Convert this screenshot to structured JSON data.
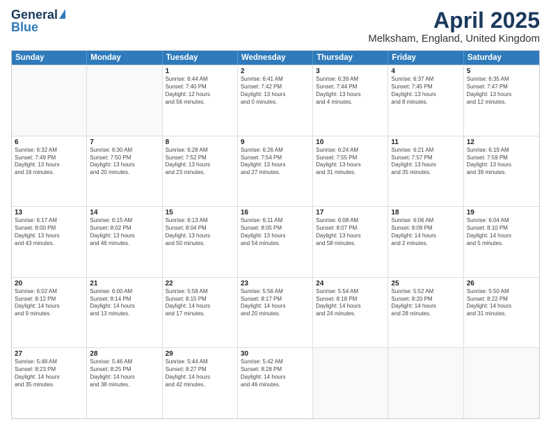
{
  "logo": {
    "general": "General",
    "blue": "Blue"
  },
  "title": "April 2025",
  "subtitle": "Melksham, England, United Kingdom",
  "weekdays": [
    "Sunday",
    "Monday",
    "Tuesday",
    "Wednesday",
    "Thursday",
    "Friday",
    "Saturday"
  ],
  "rows": [
    [
      {
        "day": "",
        "lines": []
      },
      {
        "day": "",
        "lines": []
      },
      {
        "day": "1",
        "lines": [
          "Sunrise: 6:44 AM",
          "Sunset: 7:40 PM",
          "Daylight: 12 hours",
          "and 56 minutes."
        ]
      },
      {
        "day": "2",
        "lines": [
          "Sunrise: 6:41 AM",
          "Sunset: 7:42 PM",
          "Daylight: 13 hours",
          "and 0 minutes."
        ]
      },
      {
        "day": "3",
        "lines": [
          "Sunrise: 6:39 AM",
          "Sunset: 7:44 PM",
          "Daylight: 13 hours",
          "and 4 minutes."
        ]
      },
      {
        "day": "4",
        "lines": [
          "Sunrise: 6:37 AM",
          "Sunset: 7:45 PM",
          "Daylight: 13 hours",
          "and 8 minutes."
        ]
      },
      {
        "day": "5",
        "lines": [
          "Sunrise: 6:35 AM",
          "Sunset: 7:47 PM",
          "Daylight: 13 hours",
          "and 12 minutes."
        ]
      }
    ],
    [
      {
        "day": "6",
        "lines": [
          "Sunrise: 6:32 AM",
          "Sunset: 7:49 PM",
          "Daylight: 13 hours",
          "and 16 minutes."
        ]
      },
      {
        "day": "7",
        "lines": [
          "Sunrise: 6:30 AM",
          "Sunset: 7:50 PM",
          "Daylight: 13 hours",
          "and 20 minutes."
        ]
      },
      {
        "day": "8",
        "lines": [
          "Sunrise: 6:28 AM",
          "Sunset: 7:52 PM",
          "Daylight: 13 hours",
          "and 23 minutes."
        ]
      },
      {
        "day": "9",
        "lines": [
          "Sunrise: 6:26 AM",
          "Sunset: 7:54 PM",
          "Daylight: 13 hours",
          "and 27 minutes."
        ]
      },
      {
        "day": "10",
        "lines": [
          "Sunrise: 6:24 AM",
          "Sunset: 7:55 PM",
          "Daylight: 13 hours",
          "and 31 minutes."
        ]
      },
      {
        "day": "11",
        "lines": [
          "Sunrise: 6:21 AM",
          "Sunset: 7:57 PM",
          "Daylight: 13 hours",
          "and 35 minutes."
        ]
      },
      {
        "day": "12",
        "lines": [
          "Sunrise: 6:19 AM",
          "Sunset: 7:59 PM",
          "Daylight: 13 hours",
          "and 39 minutes."
        ]
      }
    ],
    [
      {
        "day": "13",
        "lines": [
          "Sunrise: 6:17 AM",
          "Sunset: 8:00 PM",
          "Daylight: 13 hours",
          "and 43 minutes."
        ]
      },
      {
        "day": "14",
        "lines": [
          "Sunrise: 6:15 AM",
          "Sunset: 8:02 PM",
          "Daylight: 13 hours",
          "and 46 minutes."
        ]
      },
      {
        "day": "15",
        "lines": [
          "Sunrise: 6:13 AM",
          "Sunset: 8:04 PM",
          "Daylight: 13 hours",
          "and 50 minutes."
        ]
      },
      {
        "day": "16",
        "lines": [
          "Sunrise: 6:11 AM",
          "Sunset: 8:05 PM",
          "Daylight: 13 hours",
          "and 54 minutes."
        ]
      },
      {
        "day": "17",
        "lines": [
          "Sunrise: 6:08 AM",
          "Sunset: 8:07 PM",
          "Daylight: 13 hours",
          "and 58 minutes."
        ]
      },
      {
        "day": "18",
        "lines": [
          "Sunrise: 6:06 AM",
          "Sunset: 8:09 PM",
          "Daylight: 14 hours",
          "and 2 minutes."
        ]
      },
      {
        "day": "19",
        "lines": [
          "Sunrise: 6:04 AM",
          "Sunset: 8:10 PM",
          "Daylight: 14 hours",
          "and 5 minutes."
        ]
      }
    ],
    [
      {
        "day": "20",
        "lines": [
          "Sunrise: 6:02 AM",
          "Sunset: 8:12 PM",
          "Daylight: 14 hours",
          "and 9 minutes."
        ]
      },
      {
        "day": "21",
        "lines": [
          "Sunrise: 6:00 AM",
          "Sunset: 8:14 PM",
          "Daylight: 14 hours",
          "and 13 minutes."
        ]
      },
      {
        "day": "22",
        "lines": [
          "Sunrise: 5:58 AM",
          "Sunset: 8:15 PM",
          "Daylight: 14 hours",
          "and 17 minutes."
        ]
      },
      {
        "day": "23",
        "lines": [
          "Sunrise: 5:56 AM",
          "Sunset: 8:17 PM",
          "Daylight: 14 hours",
          "and 20 minutes."
        ]
      },
      {
        "day": "24",
        "lines": [
          "Sunrise: 5:54 AM",
          "Sunset: 8:18 PM",
          "Daylight: 14 hours",
          "and 24 minutes."
        ]
      },
      {
        "day": "25",
        "lines": [
          "Sunrise: 5:52 AM",
          "Sunset: 8:20 PM",
          "Daylight: 14 hours",
          "and 28 minutes."
        ]
      },
      {
        "day": "26",
        "lines": [
          "Sunrise: 5:50 AM",
          "Sunset: 8:22 PM",
          "Daylight: 14 hours",
          "and 31 minutes."
        ]
      }
    ],
    [
      {
        "day": "27",
        "lines": [
          "Sunrise: 5:48 AM",
          "Sunset: 8:23 PM",
          "Daylight: 14 hours",
          "and 35 minutes."
        ]
      },
      {
        "day": "28",
        "lines": [
          "Sunrise: 5:46 AM",
          "Sunset: 8:25 PM",
          "Daylight: 14 hours",
          "and 38 minutes."
        ]
      },
      {
        "day": "29",
        "lines": [
          "Sunrise: 5:44 AM",
          "Sunset: 8:27 PM",
          "Daylight: 14 hours",
          "and 42 minutes."
        ]
      },
      {
        "day": "30",
        "lines": [
          "Sunrise: 5:42 AM",
          "Sunset: 8:28 PM",
          "Daylight: 14 hours",
          "and 46 minutes."
        ]
      },
      {
        "day": "",
        "lines": []
      },
      {
        "day": "",
        "lines": []
      },
      {
        "day": "",
        "lines": []
      }
    ]
  ]
}
